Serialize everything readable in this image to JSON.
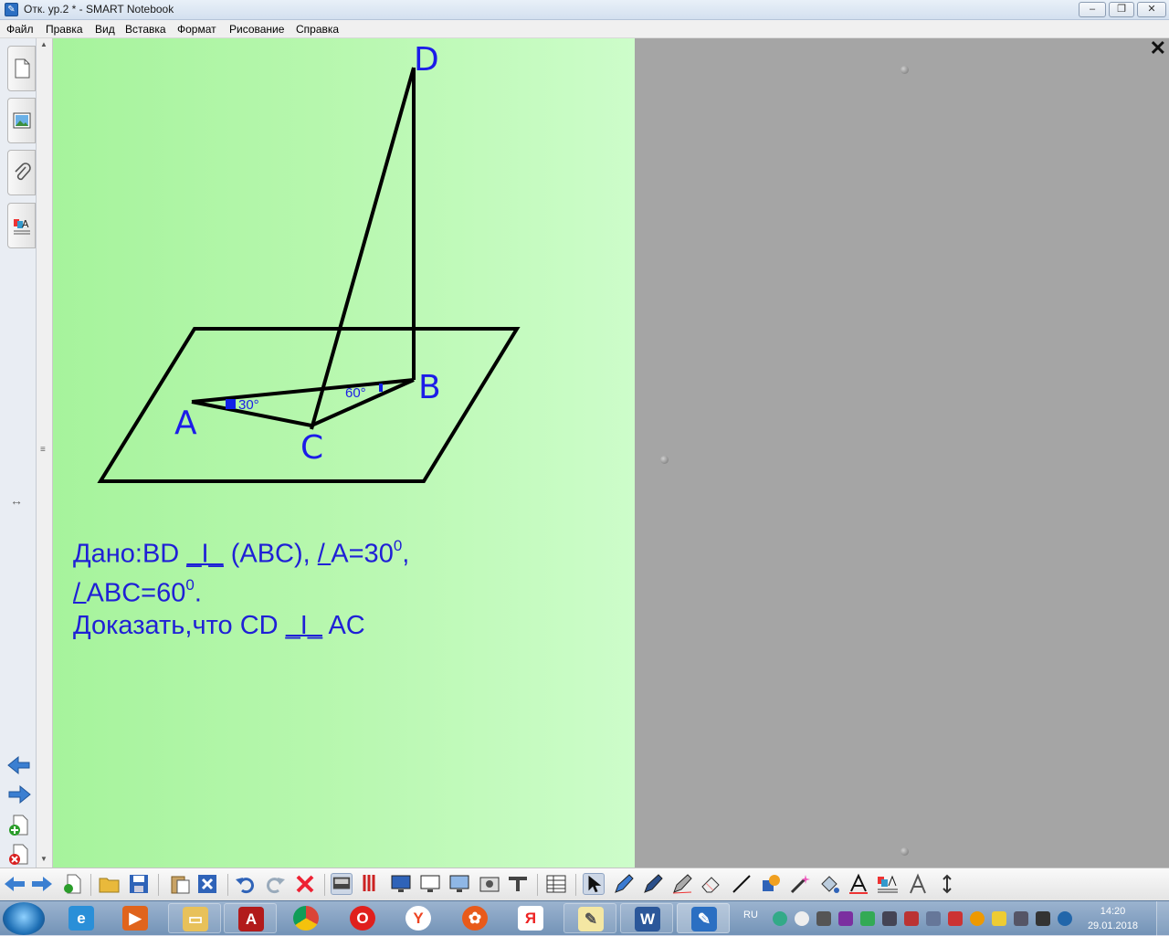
{
  "window": {
    "title": "Отк. ур.2 * - SMART Notebook",
    "app_icon": "notebook-icon",
    "controls": [
      "minimize-icon",
      "restore-icon",
      "close-icon"
    ]
  },
  "menu": {
    "items": [
      "Файл",
      "Правка",
      "Вид",
      "Вставка",
      "Формат",
      "Рисование",
      "Справка"
    ]
  },
  "side_tabs": [
    "page-sorter-icon",
    "gallery-icon",
    "attachments-icon",
    "properties-icon"
  ],
  "page_nav": [
    "back-arrow-icon",
    "forward-arrow-icon",
    "add-page-icon",
    "delete-page-icon"
  ],
  "canvas": {
    "vertex_labels": {
      "A": "A",
      "B": "B",
      "C": "C",
      "D": "D"
    },
    "angle_labels": {
      "at_A": "30°",
      "at_B": "60°"
    },
    "given": {
      "line1_prefix": "Дано:BD ",
      "perp": "_I_",
      "line1_mid": " (ABC), ",
      "angle_sign": "/ ",
      "line1_angle": "A=30",
      "exp": "0",
      "line1_end": ",",
      "line2_angle": "ABC=60",
      "line2_end": ".",
      "line3_prefix": "Доказать,что CD ",
      "line3_end": " AC"
    }
  },
  "gray_area": {
    "close_label": "✕"
  },
  "toolbar": {
    "icons": [
      "back-icon",
      "forward-icon",
      "add-page-icon",
      "open-icon",
      "save-icon",
      "paste-icon",
      "delete-icon",
      "undo-icon",
      "redo-icon",
      "clear-icon",
      "screen-shade-icon",
      "pens-icon",
      "display-icon",
      "whiteboard-icon",
      "projector-icon",
      "screen-capture-icon",
      "toolbar-icon",
      "table-icon",
      "select-icon",
      "pen-icon",
      "creative-pen-icon",
      "magic-pen-icon",
      "eraser-icon",
      "line-icon",
      "shapes-icon",
      "magic-wand-icon",
      "fill-icon",
      "text-icon",
      "properties-icon",
      "measure-icon",
      "move-toolbar-icon"
    ]
  },
  "taskbar": {
    "apps": [
      "ie-icon",
      "media-player-icon",
      "file-explorer-icon",
      "acrobat-icon",
      "chrome-icon",
      "opera-icon",
      "yandex-browser-icon",
      "media-icon",
      "yandex-icon",
      "notes-icon",
      "word-icon",
      "smart-notebook-icon"
    ],
    "lang": "RU",
    "time": "14:20",
    "date": "29.01.2018"
  }
}
